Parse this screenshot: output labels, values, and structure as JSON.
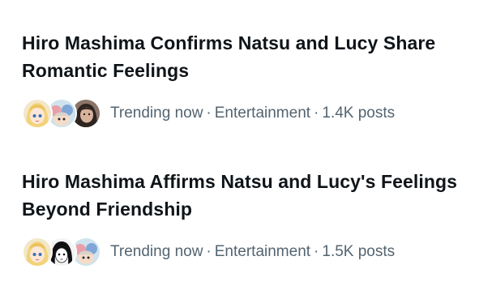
{
  "trends": [
    {
      "headline": "Hiro Mashima Confirms Natsu and Lucy Share Romantic Feelings",
      "status": "Trending now",
      "category": "Entertainment",
      "posts": "1.4K posts",
      "avatars": [
        "lucy-avatar",
        "anime-group-avatar",
        "person-photo-avatar"
      ]
    },
    {
      "headline": "Hiro Mashima Affirms Natsu and Lucy's Feelings Beyond Friendship",
      "status": "Trending now",
      "category": "Entertainment",
      "posts": "1.5K posts",
      "avatars": [
        "lucy-avatar",
        "manga-sketch-avatar",
        "anime-group-avatar"
      ]
    }
  ],
  "separator": "·",
  "colors": {
    "headline": "#0f1419",
    "meta": "#536471",
    "background": "#ffffff"
  }
}
